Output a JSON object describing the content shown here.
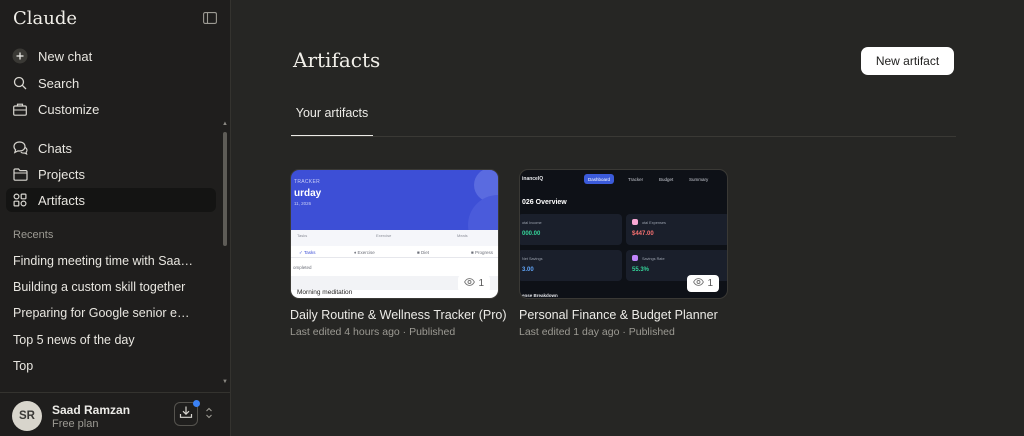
{
  "app": {
    "title": "Claude"
  },
  "sidebar": {
    "nav": [
      {
        "label": "New chat",
        "icon": "plus-icon"
      },
      {
        "label": "Search",
        "icon": "search-icon"
      },
      {
        "label": "Customize",
        "icon": "briefcase-icon"
      },
      {
        "label": "Chats",
        "icon": "chat-bubbles-icon"
      },
      {
        "label": "Projects",
        "icon": "folder-icon"
      },
      {
        "label": "Artifacts",
        "icon": "artifacts-grid-icon",
        "active": true
      }
    ],
    "recents_label": "Recents",
    "recents": [
      "Finding meeting time with Saad ...",
      "Building a custom skill together",
      "Preparing for Google senior engi...",
      "Top 5 news of the day",
      "Top"
    ],
    "user": {
      "initials": "SR",
      "name": "Saad Ramzan",
      "plan": "Free plan"
    }
  },
  "main": {
    "title": "Artifacts",
    "new_button": "New artifact",
    "tabs": [
      {
        "label": "Your artifacts",
        "active": true
      }
    ],
    "artifacts": [
      {
        "title": "Daily Routine & Wellness Tracker (Pro)",
        "meta": "Last edited 4 hours ago · Published",
        "views": "1",
        "preview": {
          "kicker": "TRACKER",
          "day": "urday",
          "date": "11, 2026",
          "stats": [
            "Tasks",
            "Exercise",
            "Meals"
          ],
          "tabs": [
            "✓ Tasks",
            "♦ Exercise",
            "■ Diet",
            "■ Progress"
          ],
          "section": "ompleted",
          "item": "Morning meditation"
        }
      },
      {
        "title": "Personal Finance & Budget Planner",
        "meta": "Last edited 1 day ago · Published",
        "views": "1",
        "preview": {
          "brand": "inanceIQ",
          "nav": [
            "Dashboard",
            "Tracker",
            "Budget",
            "Summary"
          ],
          "heading": "026 Overview",
          "boxes": [
            {
              "label": "otal Income",
              "value": "000.00",
              "color": "#34D399"
            },
            {
              "label": "otal Expenses",
              "value": "$447.00",
              "color": "#F87171"
            },
            {
              "label": "Net Savings",
              "value": "3.00",
              "color": "#60A5FA"
            },
            {
              "label": "Savings Rate",
              "value": "55.3%",
              "color": "#34D399"
            }
          ],
          "breakdown": "ense Breakdown"
        }
      }
    ]
  },
  "colors": {
    "background": "#262624",
    "sidebar": "#1F1E1D",
    "accent_blue": "#3B82F6"
  }
}
